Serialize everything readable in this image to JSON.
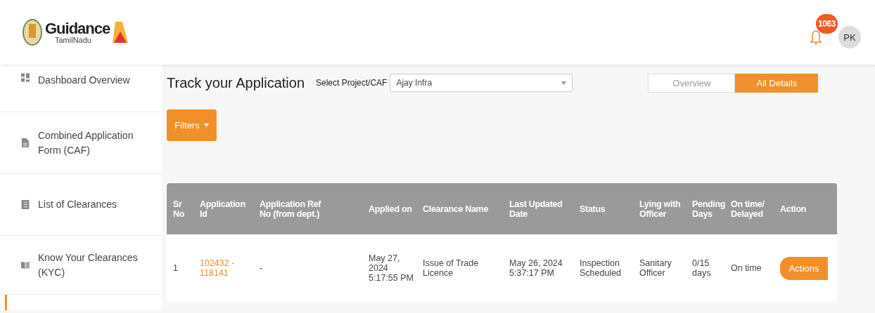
{
  "header": {
    "logo": {
      "title": "Guidance",
      "subtitle": "TamilNadu"
    },
    "notifications": {
      "count": "1063"
    },
    "avatar": "PK"
  },
  "sidebar": {
    "items": [
      {
        "label": "Dashboard Overview"
      },
      {
        "label": "Combined Application Form (CAF)"
      },
      {
        "label": "List of Clearances"
      },
      {
        "label": "Know Your Clearances (KYC)"
      }
    ]
  },
  "page": {
    "title": "Track your Application",
    "project_label": "Select Project/CAF",
    "project_value": "Ajay Infra",
    "tabs": [
      {
        "label": "Overview",
        "selected": false
      },
      {
        "label": "All Details",
        "selected": true
      }
    ],
    "filters_button": "Filters"
  },
  "table": {
    "columns": [
      "Sr No",
      "Application Id",
      "Application Ref No (from dept.)",
      "Applied on",
      "Clearance Name",
      "Last Updated Date",
      "Status",
      "Lying with Officer",
      "Pending Days",
      "On time/ Delayed",
      "Action"
    ],
    "rows": [
      {
        "cells": [
          "1",
          "102432 - 118141",
          "-",
          "May 27, 2024 5:17:55 PM",
          "Issue of Trade Licence",
          "May 26, 2024 5:37:17 PM",
          "Inspection Scheduled",
          "Sanitary Officer",
          "0/15 days",
          "On time"
        ],
        "action": "Actions"
      }
    ]
  }
}
